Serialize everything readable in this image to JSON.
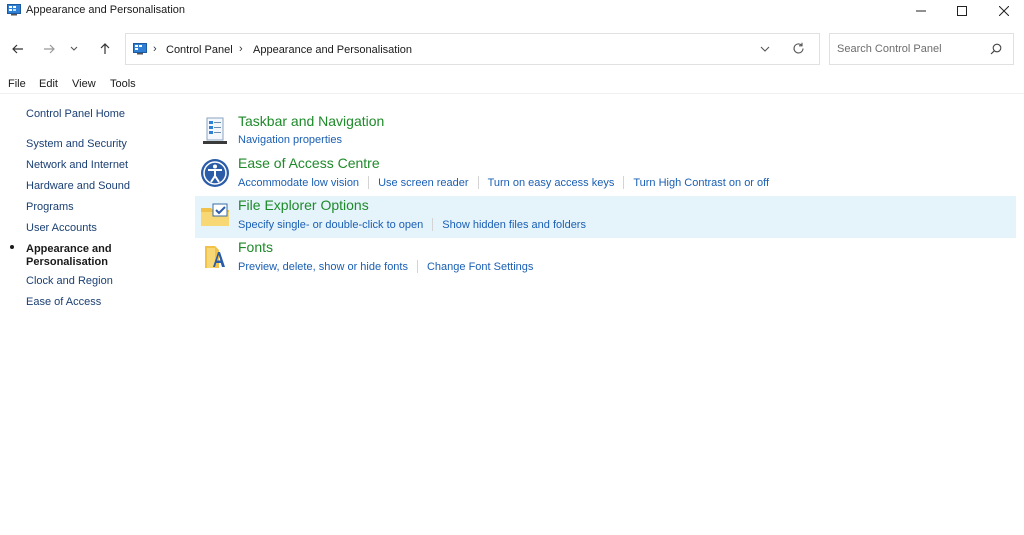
{
  "window": {
    "title": "Appearance and Personalisation",
    "icon": "control-panel-icon"
  },
  "nav": {
    "breadcrumbs": [
      "Control Panel",
      "Appearance and Personalisation"
    ],
    "search_placeholder": "Search Control Panel"
  },
  "menu": [
    "File",
    "Edit",
    "View",
    "Tools"
  ],
  "sidebar": {
    "home": "Control Panel Home",
    "items": [
      "System and Security",
      "Network and Internet",
      "Hardware and Sound",
      "Programs",
      "User Accounts",
      "Appearance and Personalisation",
      "Clock and Region",
      "Ease of Access"
    ],
    "current_index": 5
  },
  "categories": [
    {
      "title": "Taskbar and Navigation",
      "icon": "taskbar-icon",
      "links": [
        "Navigation properties"
      ]
    },
    {
      "title": "Ease of Access Centre",
      "icon": "ease-of-access-icon",
      "links": [
        "Accommodate low vision",
        "Use screen reader",
        "Turn on easy access keys",
        "Turn High Contrast on or off"
      ]
    },
    {
      "title": "File Explorer Options",
      "icon": "folder-options-icon",
      "links": [
        "Specify single- or double-click to open",
        "Show hidden files and folders"
      ],
      "highlighted": true
    },
    {
      "title": "Fonts",
      "icon": "fonts-icon",
      "links": [
        "Preview, delete, show or hide fonts",
        "Change Font Settings"
      ]
    }
  ],
  "colors": {
    "category_title": "#1e8a2a",
    "link": "#1a5fb4",
    "sidebar_link": "#1a3f73",
    "highlight": "#e5f3fb"
  }
}
